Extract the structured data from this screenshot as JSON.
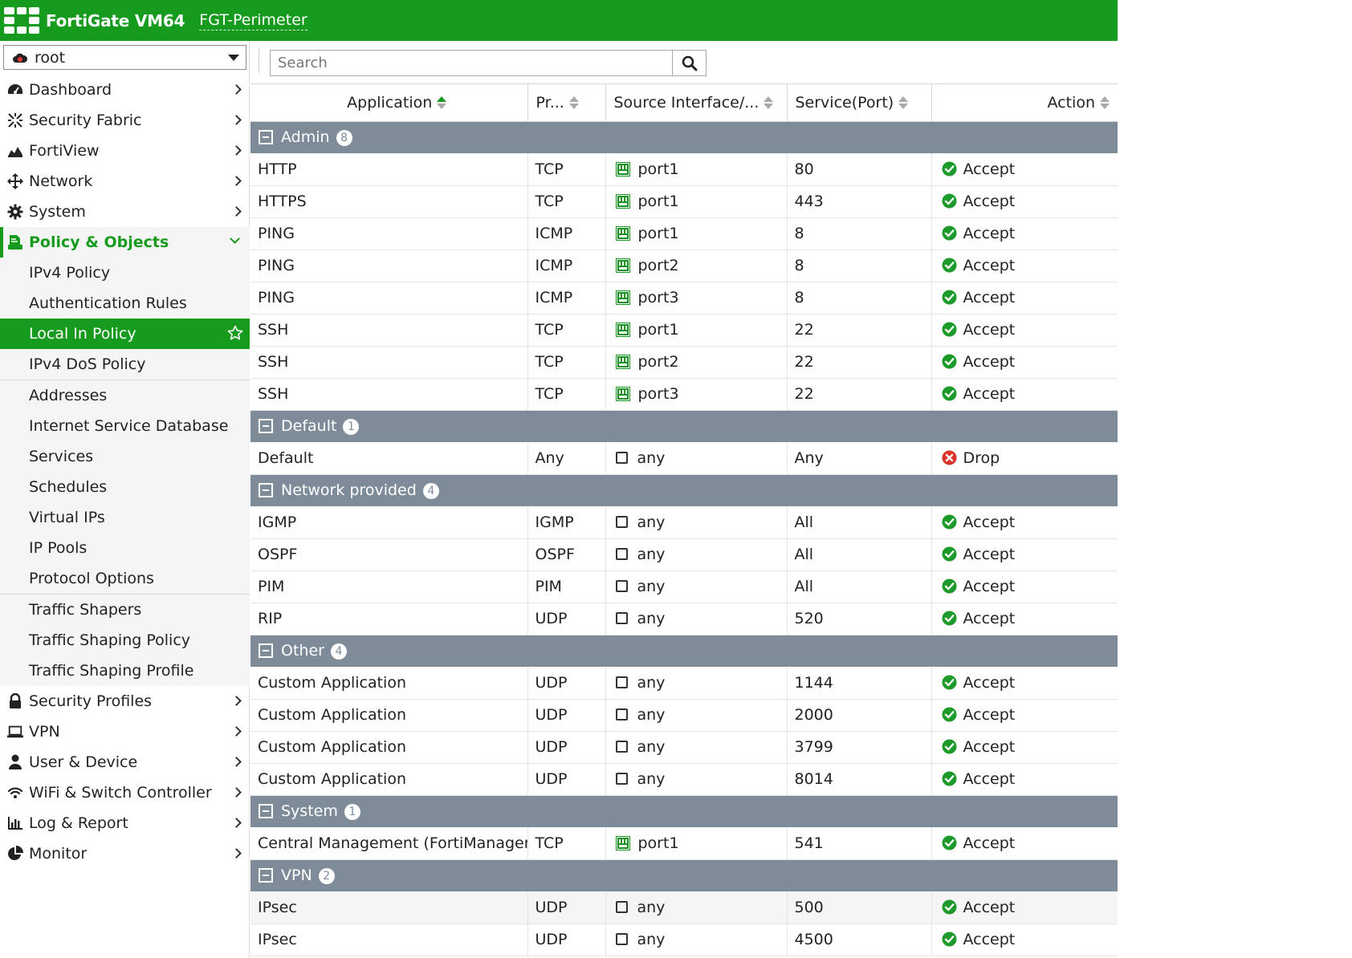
{
  "header": {
    "product": "FortiGate VM64",
    "hostname": "FGT-Perimeter"
  },
  "vdom": {
    "value": "root",
    "icon": "vdom-cloud-icon"
  },
  "sidebar": {
    "items": [
      {
        "label": "Dashboard",
        "icon": "dashboard-icon"
      },
      {
        "label": "Security Fabric",
        "icon": "security-fabric-icon"
      },
      {
        "label": "FortiView",
        "icon": "fortiview-icon"
      },
      {
        "label": "Network",
        "icon": "network-icon"
      },
      {
        "label": "System",
        "icon": "gear-icon"
      },
      {
        "label": "Policy & Objects",
        "icon": "policy-objects-icon"
      }
    ],
    "submenu": [
      {
        "label": "IPv4 Policy"
      },
      {
        "label": "Authentication Rules"
      },
      {
        "label": "Local In Policy",
        "active": true
      },
      {
        "label": "IPv4 DoS Policy"
      },
      {
        "label": "Addresses"
      },
      {
        "label": "Internet Service Database"
      },
      {
        "label": "Services"
      },
      {
        "label": "Schedules"
      },
      {
        "label": "Virtual IPs"
      },
      {
        "label": "IP Pools"
      },
      {
        "label": "Protocol Options"
      },
      {
        "label": "Traffic Shapers"
      },
      {
        "label": "Traffic Shaping Policy"
      },
      {
        "label": "Traffic Shaping Profile"
      }
    ],
    "items_after": [
      {
        "label": "Security Profiles",
        "icon": "lock-icon"
      },
      {
        "label": "VPN",
        "icon": "laptop-icon"
      },
      {
        "label": "User & Device",
        "icon": "user-icon"
      },
      {
        "label": "WiFi & Switch Controller",
        "icon": "wifi-icon"
      },
      {
        "label": "Log & Report",
        "icon": "bar-chart-icon"
      },
      {
        "label": "Monitor",
        "icon": "pie-chart-icon"
      }
    ]
  },
  "search": {
    "placeholder": "Search"
  },
  "table": {
    "columns": [
      "Application",
      "Pr...",
      "Source Interface/...",
      "Service(Port)",
      "Action"
    ],
    "groups": [
      {
        "name": "Admin",
        "count": "8",
        "rows": [
          {
            "app": "HTTP",
            "proto": "TCP",
            "src": "port1",
            "src_type": "port",
            "svc": "80",
            "action": "Accept"
          },
          {
            "app": "HTTPS",
            "proto": "TCP",
            "src": "port1",
            "src_type": "port",
            "svc": "443",
            "action": "Accept"
          },
          {
            "app": "PING",
            "proto": "ICMP",
            "src": "port1",
            "src_type": "port",
            "svc": "8",
            "action": "Accept"
          },
          {
            "app": "PING",
            "proto": "ICMP",
            "src": "port2",
            "src_type": "port",
            "svc": "8",
            "action": "Accept"
          },
          {
            "app": "PING",
            "proto": "ICMP",
            "src": "port3",
            "src_type": "port",
            "svc": "8",
            "action": "Accept"
          },
          {
            "app": "SSH",
            "proto": "TCP",
            "src": "port1",
            "src_type": "port",
            "svc": "22",
            "action": "Accept"
          },
          {
            "app": "SSH",
            "proto": "TCP",
            "src": "port2",
            "src_type": "port",
            "svc": "22",
            "action": "Accept"
          },
          {
            "app": "SSH",
            "proto": "TCP",
            "src": "port3",
            "src_type": "port",
            "svc": "22",
            "action": "Accept"
          }
        ]
      },
      {
        "name": "Default",
        "count": "1",
        "rows": [
          {
            "app": "Default",
            "proto": "Any",
            "src": "any",
            "src_type": "any",
            "svc": "Any",
            "action": "Drop"
          }
        ]
      },
      {
        "name": "Network provided",
        "count": "4",
        "rows": [
          {
            "app": "IGMP",
            "proto": "IGMP",
            "src": "any",
            "src_type": "any",
            "svc": "All",
            "action": "Accept"
          },
          {
            "app": "OSPF",
            "proto": "OSPF",
            "src": "any",
            "src_type": "any",
            "svc": "All",
            "action": "Accept"
          },
          {
            "app": "PIM",
            "proto": "PIM",
            "src": "any",
            "src_type": "any",
            "svc": "All",
            "action": "Accept"
          },
          {
            "app": "RIP",
            "proto": "UDP",
            "src": "any",
            "src_type": "any",
            "svc": "520",
            "action": "Accept"
          }
        ]
      },
      {
        "name": "Other",
        "count": "4",
        "rows": [
          {
            "app": "Custom Application",
            "proto": "UDP",
            "src": "any",
            "src_type": "any",
            "svc": "1144",
            "action": "Accept"
          },
          {
            "app": "Custom Application",
            "proto": "UDP",
            "src": "any",
            "src_type": "any",
            "svc": "2000",
            "action": "Accept"
          },
          {
            "app": "Custom Application",
            "proto": "UDP",
            "src": "any",
            "src_type": "any",
            "svc": "3799",
            "action": "Accept"
          },
          {
            "app": "Custom Application",
            "proto": "UDP",
            "src": "any",
            "src_type": "any",
            "svc": "8014",
            "action": "Accept"
          }
        ]
      },
      {
        "name": "System",
        "count": "1",
        "rows": [
          {
            "app": "Central Management (FortiManager)",
            "proto": "TCP",
            "src": "port1",
            "src_type": "port",
            "svc": "541",
            "action": "Accept"
          }
        ]
      },
      {
        "name": "VPN",
        "count": "2",
        "rows": [
          {
            "app": "IPsec",
            "proto": "UDP",
            "src": "any",
            "src_type": "any",
            "svc": "500",
            "action": "Accept",
            "shade": true
          },
          {
            "app": "IPsec",
            "proto": "UDP",
            "src": "any",
            "src_type": "any",
            "svc": "4500",
            "action": "Accept"
          }
        ]
      }
    ]
  },
  "colors": {
    "brand_green": "#179b1f",
    "group_header": "#7e8c9a",
    "accept_green": "#1d9b2a",
    "drop_red": "#d9332b"
  }
}
